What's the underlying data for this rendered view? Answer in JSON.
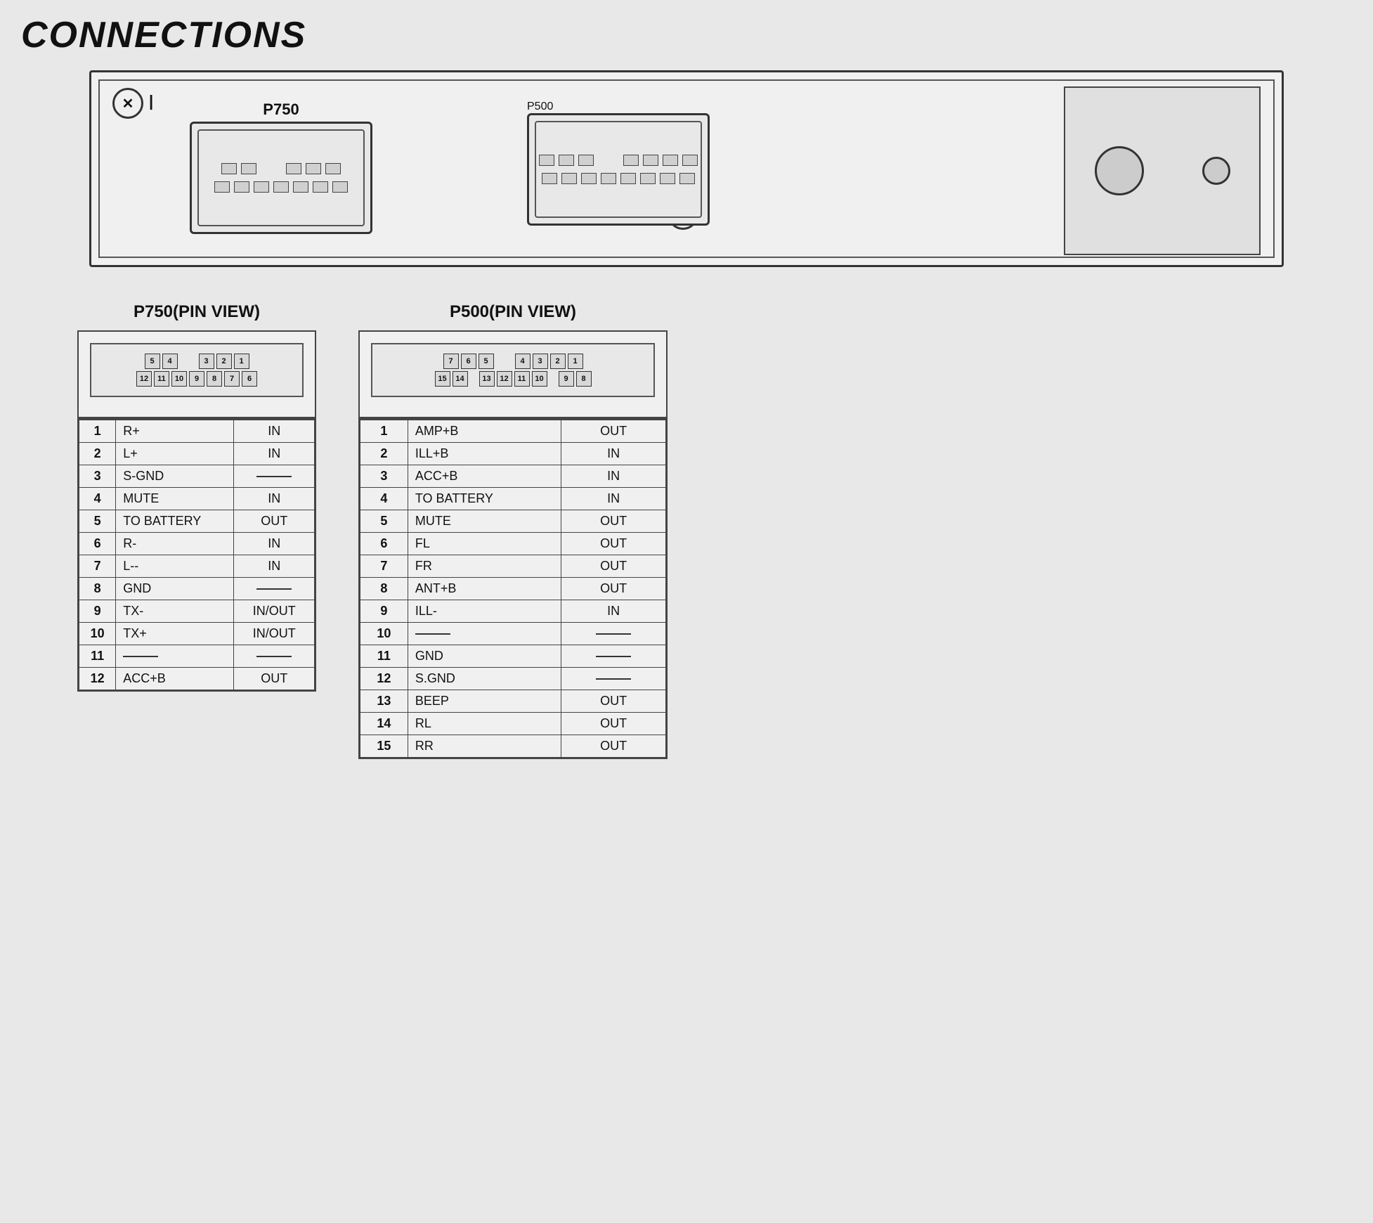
{
  "title": "CONNECTIONS",
  "connectors": {
    "p750": {
      "label": "P750",
      "pin_view_title": "P750(PIN VIEW)",
      "row1": [
        "5",
        "4",
        "",
        "3",
        "2",
        "1"
      ],
      "row2": [
        "12",
        "11",
        "10",
        "9",
        "8",
        "7",
        "6"
      ],
      "pins": [
        {
          "num": "1",
          "signal": "R+",
          "dir": "IN"
        },
        {
          "num": "2",
          "signal": "L+",
          "dir": "IN"
        },
        {
          "num": "3",
          "signal": "S-GND",
          "dir": "—"
        },
        {
          "num": "4",
          "signal": "MUTE",
          "dir": "IN"
        },
        {
          "num": "5",
          "signal": "TO BATTERY",
          "dir": "OUT"
        },
        {
          "num": "6",
          "signal": "R-",
          "dir": "IN"
        },
        {
          "num": "7",
          "signal": "L--",
          "dir": "IN"
        },
        {
          "num": "8",
          "signal": "GND",
          "dir": "—"
        },
        {
          "num": "9",
          "signal": "TX-",
          "dir": "IN/OUT"
        },
        {
          "num": "10",
          "signal": "TX+",
          "dir": "IN/OUT"
        },
        {
          "num": "11",
          "signal": "—",
          "dir": "—"
        },
        {
          "num": "12",
          "signal": "ACC+B",
          "dir": "OUT"
        }
      ]
    },
    "p500": {
      "label": "P500",
      "pin_view_title": "P500(PIN VIEW)",
      "row1": [
        "7",
        "6",
        "5",
        "",
        "4",
        "3",
        "2",
        "1"
      ],
      "row2": [
        "15",
        "14",
        "",
        "13",
        "12",
        "11",
        "10",
        "",
        "9",
        "8"
      ],
      "pins": [
        {
          "num": "1",
          "signal": "AMP+B",
          "dir": "OUT"
        },
        {
          "num": "2",
          "signal": "ILL+B",
          "dir": "IN"
        },
        {
          "num": "3",
          "signal": "ACC+B",
          "dir": "IN"
        },
        {
          "num": "4",
          "signal": "TO BATTERY",
          "dir": "IN"
        },
        {
          "num": "5",
          "signal": "MUTE",
          "dir": "OUT"
        },
        {
          "num": "6",
          "signal": "FL",
          "dir": "OUT"
        },
        {
          "num": "7",
          "signal": "FR",
          "dir": "OUT"
        },
        {
          "num": "8",
          "signal": "ANT+B",
          "dir": "OUT"
        },
        {
          "num": "9",
          "signal": "ILL-",
          "dir": "IN"
        },
        {
          "num": "10",
          "signal": "—",
          "dir": "—"
        },
        {
          "num": "11",
          "signal": "GND",
          "dir": "—"
        },
        {
          "num": "12",
          "signal": "S.GND",
          "dir": "—"
        },
        {
          "num": "13",
          "signal": "BEEP",
          "dir": "OUT"
        },
        {
          "num": "14",
          "signal": "RL",
          "dir": "OUT"
        },
        {
          "num": "15",
          "signal": "RR",
          "dir": "OUT"
        }
      ]
    }
  }
}
